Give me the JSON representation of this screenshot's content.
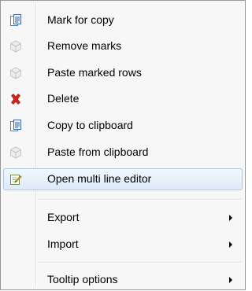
{
  "menu": {
    "items": [
      {
        "label": "Mark for copy",
        "icon": "document-copy-icon"
      },
      {
        "label": "Remove marks",
        "icon": "disabled-cube-icon"
      },
      {
        "label": "Paste marked rows",
        "icon": "disabled-cube-icon"
      },
      {
        "label": "Delete",
        "icon": "red-x-icon"
      },
      {
        "label": "Copy to clipboard",
        "icon": "document-copy-icon"
      },
      {
        "label": "Paste from clipboard",
        "icon": "disabled-cube-icon"
      },
      {
        "label": "Open multi line editor",
        "icon": "edit-note-icon",
        "highlighted": true
      },
      {
        "label": "Export",
        "submenu": true
      },
      {
        "label": "Import",
        "submenu": true
      },
      {
        "label": "Tooltip options",
        "submenu": true
      }
    ]
  },
  "colors": {
    "menu_bg": "#f7f7f7",
    "border": "#979797",
    "highlight_border": "#a8c7ea",
    "delete_red": "#d2261c"
  }
}
